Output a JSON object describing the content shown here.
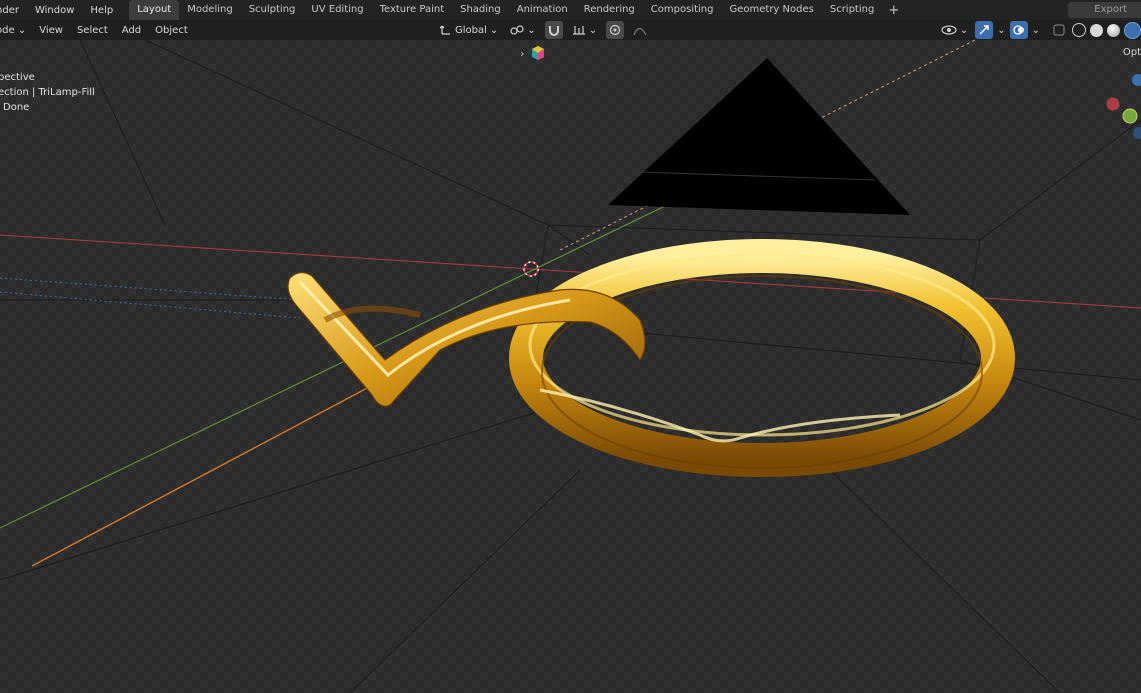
{
  "topbar": {
    "menus": [
      "nder",
      "Window",
      "Help"
    ],
    "workspaces": [
      "Layout",
      "Modeling",
      "Sculpting",
      "UV Editing",
      "Texture Paint",
      "Shading",
      "Animation",
      "Rendering",
      "Compositing",
      "Geometry Nodes",
      "Scripting"
    ],
    "active_workspace": "Layout",
    "add_tab_icon": "plus-icon",
    "export_label": "Export"
  },
  "header": {
    "mode": "ode",
    "menus": [
      "View",
      "Select",
      "Add",
      "Object"
    ],
    "orientation": "Global",
    "right_label": "Opt"
  },
  "viewport_overlay": {
    "line1": "pective",
    "line2": "ection | TriLamp-Fill",
    "line3": "Done"
  },
  "colors": {
    "x_axis": "#c0404a",
    "y_axis": "#6a9a3a",
    "gold": "#e3a51a",
    "active_tab": "#3d3d3d"
  }
}
